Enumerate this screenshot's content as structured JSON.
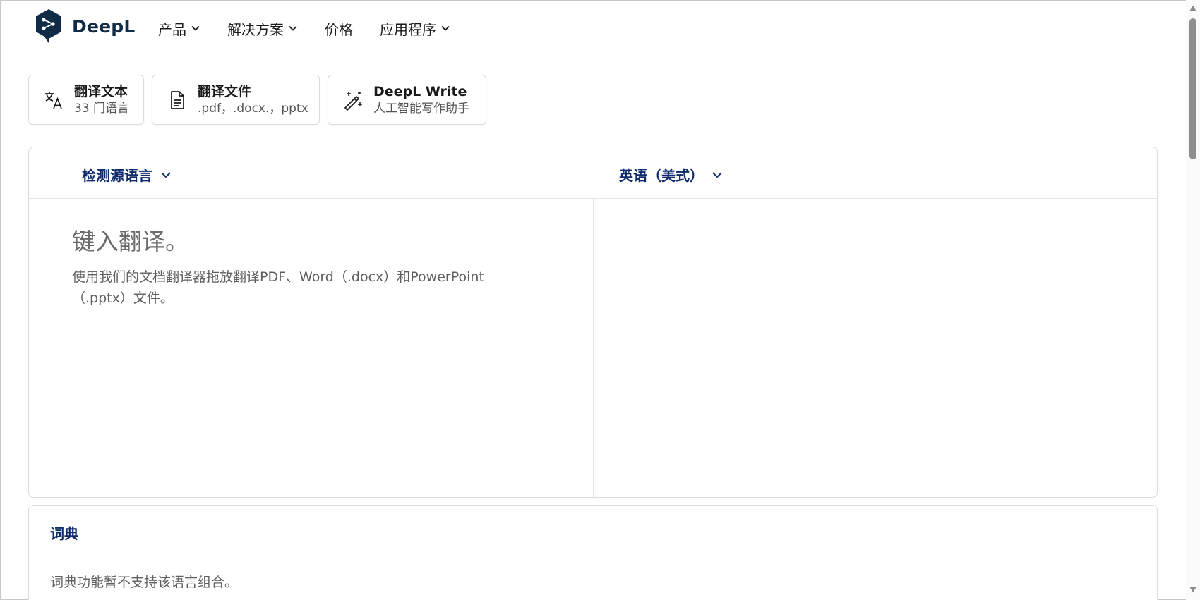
{
  "brand": {
    "name": "DeepL",
    "color": "#0f2b46"
  },
  "nav": {
    "items": [
      {
        "label": "产品",
        "has_dropdown": true
      },
      {
        "label": "解决方案",
        "has_dropdown": true
      },
      {
        "label": "价格",
        "has_dropdown": false
      },
      {
        "label": "应用程序",
        "has_dropdown": true
      }
    ]
  },
  "modes": [
    {
      "title": "翻译文本",
      "subtitle": "33 门语言",
      "icon": "translate-icon"
    },
    {
      "title": "翻译文件",
      "subtitle": ".pdf，.docx.，pptx",
      "icon": "document-icon"
    },
    {
      "title": "DeepL Write",
      "subtitle": "人工智能写作助手",
      "icon": "magic-wand-icon"
    }
  ],
  "translator": {
    "source_language": "检测源语言",
    "target_language": "英语（美式）",
    "placeholder": "键入翻译。",
    "hint": "使用我们的文档翻译器拖放翻译PDF、Word（.docx）和PowerPoint（.pptx）文件。",
    "accent_color": "#0f2b6b"
  },
  "dictionary": {
    "title": "词典",
    "message": "词典功能暂不支持该语言组合。"
  }
}
